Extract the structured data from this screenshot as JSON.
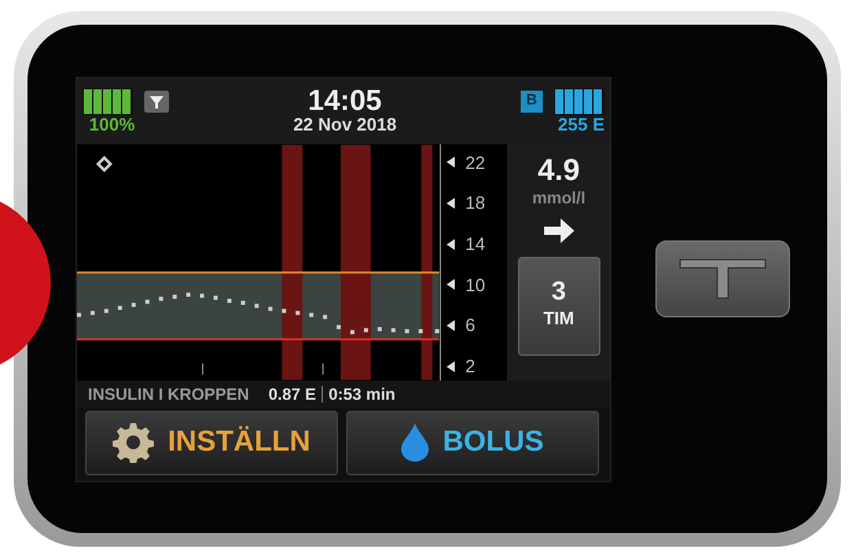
{
  "status_bar": {
    "battery_percent": "100%",
    "time": "14:05",
    "date": "22 Nov 2018",
    "bluetooth_badge": "B",
    "insulin_remaining": "255 E"
  },
  "chart": {
    "y_axis_labels": [
      "22",
      "18",
      "14",
      "10",
      "6",
      "2"
    ]
  },
  "reading": {
    "value": "4.9",
    "unit": "mmol/l"
  },
  "time_range_button": {
    "value": "3",
    "unit": "TIM"
  },
  "insulin_on_board": {
    "label": "INSULIN I KROPPEN",
    "amount": "0.87 E",
    "time": "0:53 min"
  },
  "buttons": [
    {
      "kind": "settings",
      "label": "INSTÄLLN"
    },
    {
      "kind": "bolus",
      "label": "BOLUS"
    }
  ]
}
